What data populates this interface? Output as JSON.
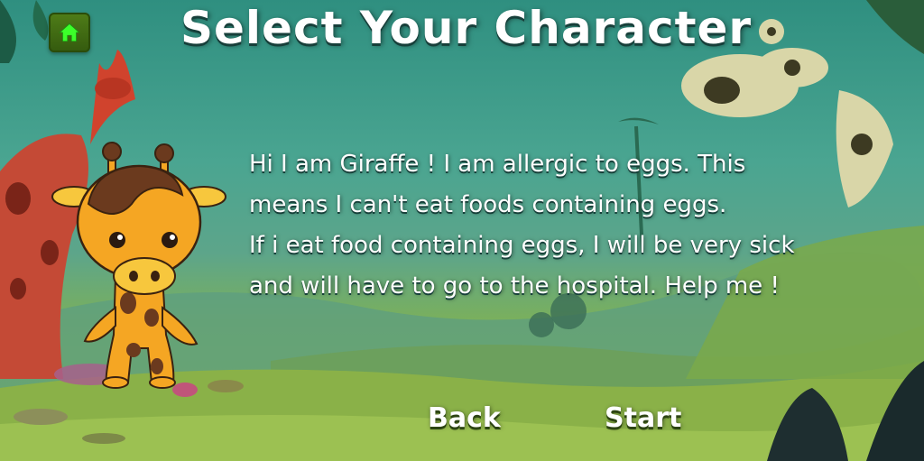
{
  "header": {
    "title": "Select Your Character",
    "home_icon": "home-icon"
  },
  "character": {
    "name": "Giraffe",
    "bio_lines": [
      "Hi I am Giraffe ! I am allergic to eggs. This",
      "means I can't eat foods containing eggs.",
      "If i eat food containing eggs, I will be very sick",
      "and will have to go to the hospital. Help me !"
    ]
  },
  "buttons": {
    "back_label": "Back",
    "start_label": "Start"
  },
  "colors": {
    "sky": "#2f8f80",
    "grass": "#8fb84a",
    "giraffe_body": "#f5a623",
    "giraffe_spots": "#6b3a1e",
    "home_button": "#4f7d18",
    "home_icon": "#3cff2a"
  }
}
